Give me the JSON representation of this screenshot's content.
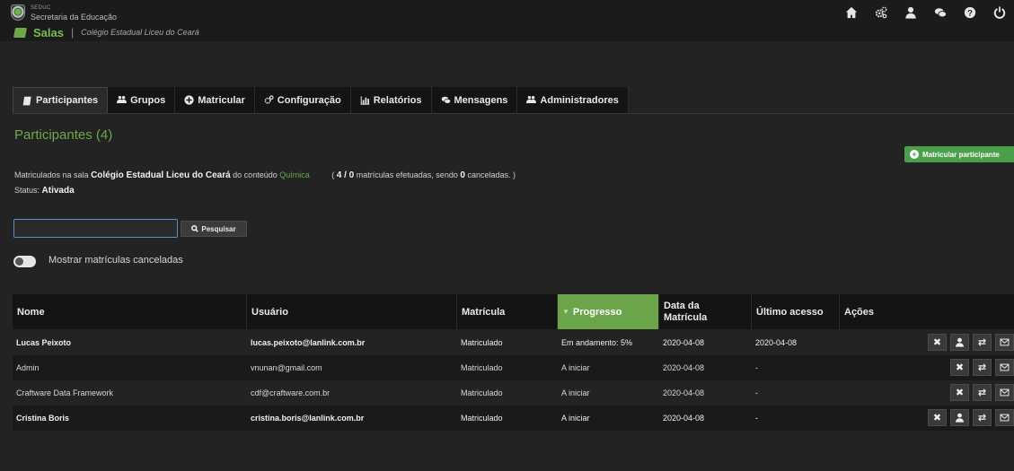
{
  "app": {
    "brand_small": "SEDUC",
    "brand_name": "Secretaria da Educação",
    "section_title": "Salas",
    "separator": "|",
    "school_name": "Colégio Estadual Liceu do Ceará"
  },
  "topbar_icons": [
    "home-icon",
    "cogs-icon",
    "user-icon",
    "chat-icon",
    "help-icon",
    "power-icon"
  ],
  "tabs": [
    {
      "label": "Participantes",
      "icon": "book-icon",
      "active": true
    },
    {
      "label": "Grupos",
      "icon": "group-icon"
    },
    {
      "label": "Matricular",
      "icon": "plus-circle-icon"
    },
    {
      "label": "Configuração",
      "icon": "cogs-icon"
    },
    {
      "label": "Relatórios",
      "icon": "bar-chart-icon"
    },
    {
      "label": "Mensagens",
      "icon": "chat-icon"
    },
    {
      "label": "Administradores",
      "icon": "group-icon"
    }
  ],
  "panel": {
    "title": "Participantes (4)",
    "enroll_button": "Matricular participante",
    "info_prefix": "Matriculados na sala",
    "info_school": "Colégio Estadual Liceu do Ceará",
    "info_mid": "do conteúdo",
    "info_subject": "Química",
    "count_open": "(",
    "count_value": "4 / 0",
    "count_mid": "matrículas efetuadas, sendo",
    "count_canceled": "0",
    "count_end": "canceladas. )",
    "status_label": "Status:",
    "status_value": "Ativada"
  },
  "search": {
    "value": "",
    "placeholder": "",
    "button": "Pesquisar"
  },
  "toggle": {
    "label": "Mostrar matrículas canceladas",
    "on": false
  },
  "table": {
    "headers": {
      "nome": "Nome",
      "usuario": "Usuário",
      "matricula": "Matrícula",
      "progresso": "Progresso",
      "data_l1": "Data da",
      "data_l2": "Matrícula",
      "ultimo": "Último acesso",
      "acoes": "Ações"
    },
    "rows": [
      {
        "nome": "Lucas Peixoto",
        "usuario": "lucas.peixoto@lanlink.com.br",
        "matricula": "Matriculado",
        "progresso": "Em andamento: 5%",
        "data": "2020-04-08",
        "ultimo": "2020-04-08"
      },
      {
        "nome": "Admin",
        "usuario": "vnunan@gmail.com",
        "matricula": "Matriculado",
        "progresso": "A iniciar",
        "data": "2020-04-08",
        "ultimo": "-"
      },
      {
        "nome": "Craftware Data Framework",
        "usuario": "cdf@craftware.com.br",
        "matricula": "Matriculado",
        "progresso": "A iniciar",
        "data": "2020-04-08",
        "ultimo": "-"
      },
      {
        "nome": "Cristina Boris",
        "usuario": "cristina.boris@lanlink.com.br",
        "matricula": "Matriculado",
        "progresso": "A iniciar",
        "data": "2020-04-08",
        "ultimo": "-"
      }
    ]
  },
  "colors": {
    "accent_green": "#6ea84b",
    "button_green": "#4aa04a",
    "background": "#232323"
  }
}
